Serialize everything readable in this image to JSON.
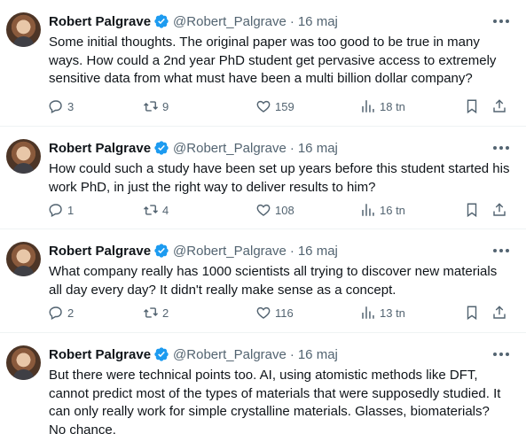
{
  "tweets": [
    {
      "name": "Robert Palgrave",
      "handle": "@Robert_Palgrave",
      "separator": "·",
      "time": "16 maj",
      "text": "Some initial thoughts. The original paper was too good to be true in many ways. How could a 2nd year PhD student get pervasive access to extremely sensitive data from what must have been a multi billion dollar company?",
      "replies": "3",
      "reposts": "9",
      "likes": "159",
      "views": "18 tn"
    },
    {
      "name": "Robert Palgrave",
      "handle": "@Robert_Palgrave",
      "separator": "·",
      "time": "16 maj",
      "text": "How could such a study have been set up years before this student started his work PhD, in just the right way to deliver results to him?",
      "replies": "1",
      "reposts": "4",
      "likes": "108",
      "views": "16 tn"
    },
    {
      "name": "Robert Palgrave",
      "handle": "@Robert_Palgrave",
      "separator": "·",
      "time": "16 maj",
      "text": "What company really has 1000 scientists all trying to discover new materials all day every day? It didn't really make sense as a concept.",
      "replies": "2",
      "reposts": "2",
      "likes": "116",
      "views": "13 tn"
    },
    {
      "name": "Robert Palgrave",
      "handle": "@Robert_Palgrave",
      "separator": "·",
      "time": "16 maj",
      "text": "But there were technical points too. AI, using atomistic methods like DFT, cannot predict most of the types of materials that were supposedly studied. It can only really work for simple crystalline materials. Glasses, biomaterials?  No chance.",
      "replies": "",
      "reposts": "",
      "likes": "",
      "views": ""
    }
  ],
  "colors": {
    "verified": "#1d9bf0",
    "muted": "#536471",
    "text": "#0f1419",
    "divider": "#eff3f4"
  },
  "icons": [
    "verified-badge-icon",
    "more-options-icon",
    "reply-icon",
    "repost-icon",
    "like-icon",
    "views-icon",
    "bookmark-icon",
    "share-icon"
  ]
}
